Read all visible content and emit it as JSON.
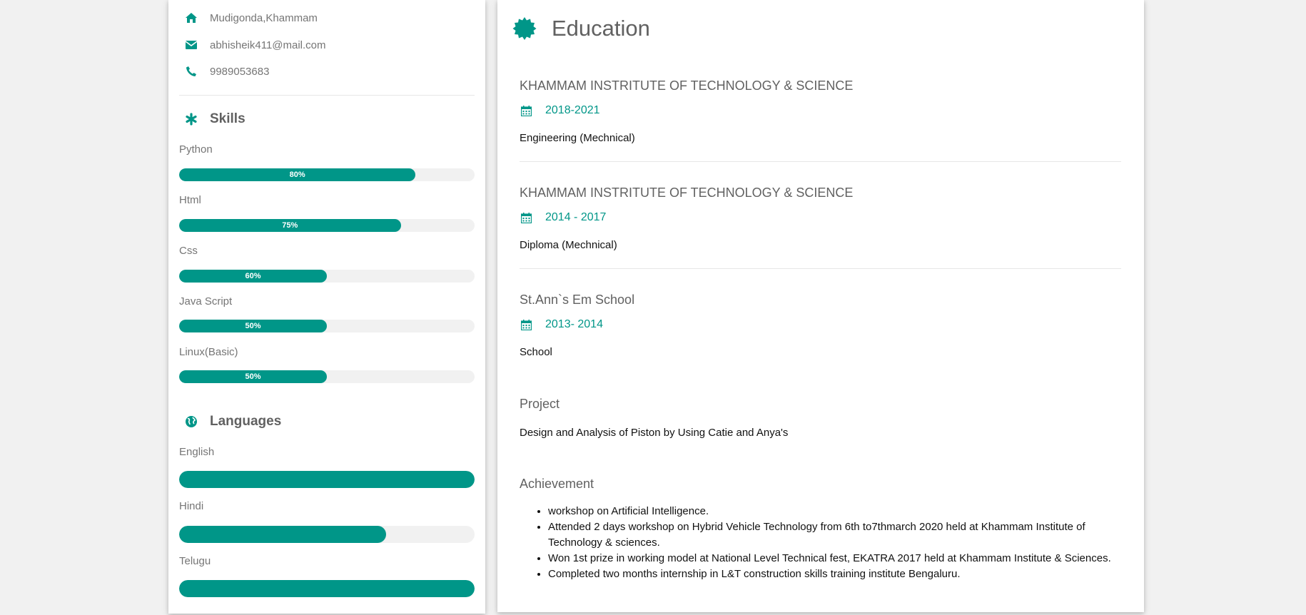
{
  "contact": {
    "address": "Mudigonda,Khammam",
    "email": "abhisheik411@mail.com",
    "phone": "9989053683"
  },
  "skills": {
    "title": "Skills",
    "items": [
      {
        "name": "Python",
        "percent": 80,
        "label": "80%"
      },
      {
        "name": "Html",
        "percent": 75,
        "label": "75%"
      },
      {
        "name": "Css",
        "percent": 50,
        "label": "60%"
      },
      {
        "name": "Java Script",
        "percent": 50,
        "label": "50%"
      },
      {
        "name": "Linux(Basic)",
        "percent": 50,
        "label": "50%"
      }
    ]
  },
  "languages": {
    "title": "Languages",
    "items": [
      {
        "name": "English",
        "percent": 100
      },
      {
        "name": "Hindi",
        "percent": 70
      },
      {
        "name": "Telugu",
        "percent": 100
      }
    ]
  },
  "education": {
    "title": "Education",
    "items": [
      {
        "school": "KHAMMAM INSTRITUTE OF TECHNOLOGY & SCIENCE",
        "years": "2018-2021",
        "degree": "Engineering (Mechnical)"
      },
      {
        "school": "KHAMMAM INSTRITUTE OF TECHNOLOGY & SCIENCE",
        "years": "2014 - 2017",
        "degree": "Diploma (Mechnical)"
      },
      {
        "school": "St.Ann`s Em School",
        "years": "2013- 2014",
        "degree": "School"
      }
    ]
  },
  "project": {
    "title": "Project",
    "text": "Design and Analysis of Piston by Using Catie and Anya's"
  },
  "achievement": {
    "title": "Achievement",
    "items": [
      "workshop on Artificial Intelligence.",
      "Attended 2 days workshop on Hybrid Vehicle Technology from 6th to7thmarch 2020 held at Khammam Institute of Technology & sciences.",
      "Won 1st prize in working model at National Level Technical fest, EKATRA 2017 held at Khammam Institute & Sciences.",
      "Completed two months internship in L&T construction skills training institute Bengaluru."
    ]
  },
  "colors": {
    "accent": "#009688",
    "track": "#f1f1f1"
  },
  "icons": [
    "home-icon",
    "envelope-icon",
    "phone-icon",
    "asterisk-icon",
    "globe-icon",
    "certificate-icon",
    "calendar-icon"
  ]
}
